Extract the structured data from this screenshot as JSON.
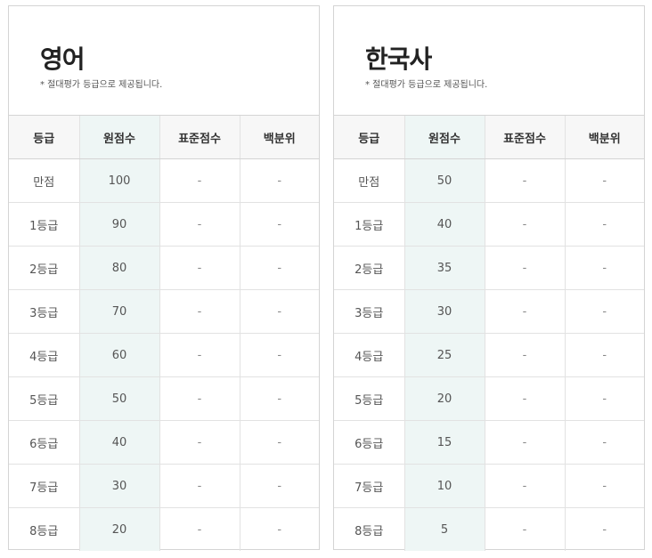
{
  "headers": [
    "등급",
    "원점수",
    "표준점수",
    "백분위"
  ],
  "panels": [
    {
      "title": "영어",
      "note": "* 절대평가 등급으로 제공됩니다.",
      "rows": [
        [
          "만점",
          "100",
          "-",
          "-"
        ],
        [
          "1등급",
          "90",
          "-",
          "-"
        ],
        [
          "2등급",
          "80",
          "-",
          "-"
        ],
        [
          "3등급",
          "70",
          "-",
          "-"
        ],
        [
          "4등급",
          "60",
          "-",
          "-"
        ],
        [
          "5등급",
          "50",
          "-",
          "-"
        ],
        [
          "6등급",
          "40",
          "-",
          "-"
        ],
        [
          "7등급",
          "30",
          "-",
          "-"
        ],
        [
          "8등급",
          "20",
          "-",
          "-"
        ]
      ]
    },
    {
      "title": "한국사",
      "note": "* 절대평가 등급으로 제공됩니다.",
      "rows": [
        [
          "만점",
          "50",
          "-",
          "-"
        ],
        [
          "1등급",
          "40",
          "-",
          "-"
        ],
        [
          "2등급",
          "35",
          "-",
          "-"
        ],
        [
          "3등급",
          "30",
          "-",
          "-"
        ],
        [
          "4등급",
          "25",
          "-",
          "-"
        ],
        [
          "5등급",
          "20",
          "-",
          "-"
        ],
        [
          "6등급",
          "15",
          "-",
          "-"
        ],
        [
          "7등급",
          "10",
          "-",
          "-"
        ],
        [
          "8등급",
          "5",
          "-",
          "-"
        ]
      ]
    }
  ]
}
